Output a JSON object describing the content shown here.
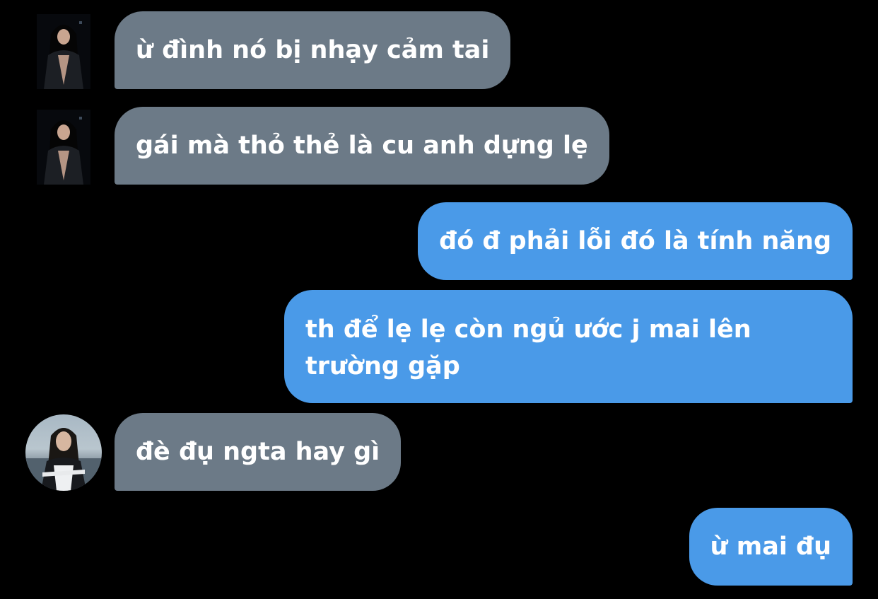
{
  "colors": {
    "background": "#000000",
    "incoming_bubble": "#6c7a87",
    "outgoing_bubble": "#4a9ae8",
    "text": "#ffffff"
  },
  "messages": [
    {
      "direction": "incoming",
      "text": "ừ đình nó bị nhạy cảm tai"
    },
    {
      "direction": "incoming",
      "text": "gái mà thỏ thẻ là cu anh dựng lẹ"
    },
    {
      "direction": "outgoing",
      "text": "đó đ phải lỗi đó là tính năng"
    },
    {
      "direction": "outgoing",
      "text": "th để lẹ lẹ còn ngủ ước j mai lên trường gặp"
    },
    {
      "direction": "incoming",
      "text": "đè đụ ngta hay gì"
    },
    {
      "direction": "outgoing",
      "text": "ừ mai đụ"
    }
  ]
}
